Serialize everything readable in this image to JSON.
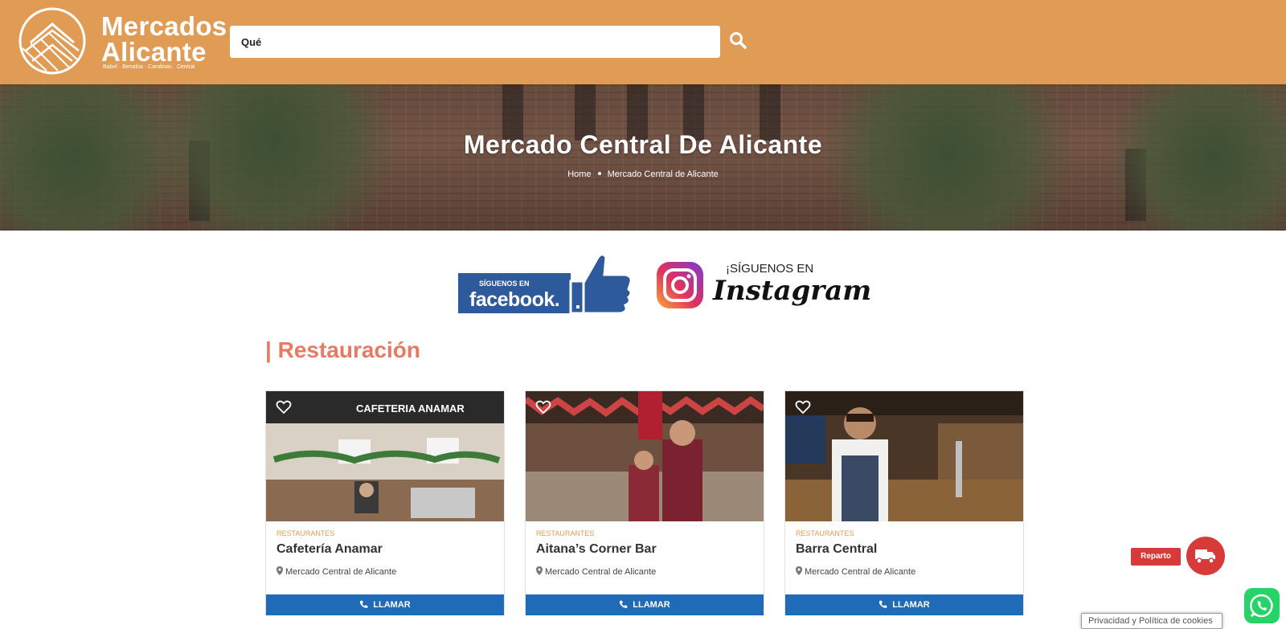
{
  "header": {
    "logo_line1": "Mercados",
    "logo_line2": "Alicante",
    "logo_tagline": "Babel · Benalúa · Carolinas · Central",
    "search_value": "Qué",
    "search_icon": "search-icon",
    "background": "#e09c55"
  },
  "hero": {
    "title": "Mercado Central De Alicante",
    "breadcrumb": [
      "Home",
      "Mercado Central de Alicante"
    ]
  },
  "social": {
    "facebook_small": "SÍGUENOS EN",
    "facebook_big": "facebook.",
    "instagram_small": "¡SÍGUENOS EN",
    "instagram_big": "Instagram"
  },
  "section": {
    "title": "| Restauración",
    "color": "#e87a63"
  },
  "cards": [
    {
      "category": "RESTAURANTES",
      "name": "Cafetería Anamar",
      "location": "Mercado Central de Alicante",
      "action": "LLAMAR",
      "sign": "CAFETERIA ANAMAR"
    },
    {
      "category": "RESTAURANTES",
      "name": "Aitana’s Corner Bar",
      "location": "Mercado Central de Alicante",
      "action": "LLAMAR"
    },
    {
      "category": "RESTAURANTES",
      "name": "Barra Central",
      "location": "Mercado Central de Alicante",
      "action": "LLAMAR"
    }
  ],
  "floating": {
    "reparto_label": "Reparto",
    "reparto_icon": "truck-icon",
    "whatsapp_icon": "whatsapp-icon",
    "cookies_label": "Privacidad y Política de cookies"
  },
  "colors": {
    "call_button": "#1f6bb8",
    "reparto": "#d83a3a",
    "whatsapp": "#25d366"
  }
}
